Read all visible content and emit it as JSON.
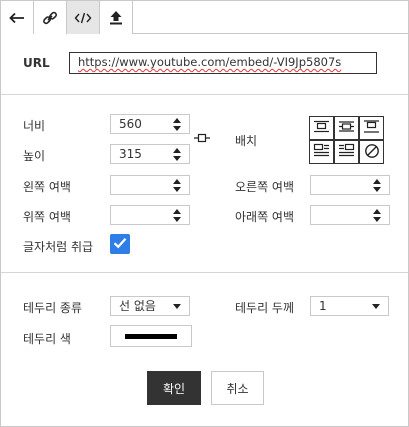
{
  "tabs": [
    {
      "icon": "arrow-left-icon",
      "selected": false
    },
    {
      "icon": "link-icon",
      "selected": false
    },
    {
      "icon": "code-icon",
      "selected": true
    },
    {
      "icon": "upload-icon",
      "selected": false
    }
  ],
  "url": {
    "label": "URL",
    "value": "https://www.youtube.com/embed/-VI9Jp5807s"
  },
  "size": {
    "width_label": "너비",
    "width_value": "560",
    "height_label": "높이",
    "height_value": "315"
  },
  "align": {
    "label": "배치"
  },
  "margins": {
    "left_label": "왼쪽 여백",
    "left_value": "",
    "right_label": "오른쪽 여백",
    "right_value": "",
    "top_label": "위쪽 여백",
    "top_value": "",
    "bottom_label": "아래쪽 여백",
    "bottom_value": ""
  },
  "treat_as_text": {
    "label": "글자처럼 취급",
    "checked": true
  },
  "border": {
    "type_label": "테두리 종류",
    "type_value": "선 없음",
    "width_label": "테두리 두께",
    "width_value": "1",
    "color_label": "테두리 색",
    "color_value": "#000000"
  },
  "buttons": {
    "confirm": "확인",
    "cancel": "취소"
  },
  "colors": {
    "accent": "#2f7ee8",
    "primary_button": "#333333",
    "spellcheck": "#e53935"
  }
}
